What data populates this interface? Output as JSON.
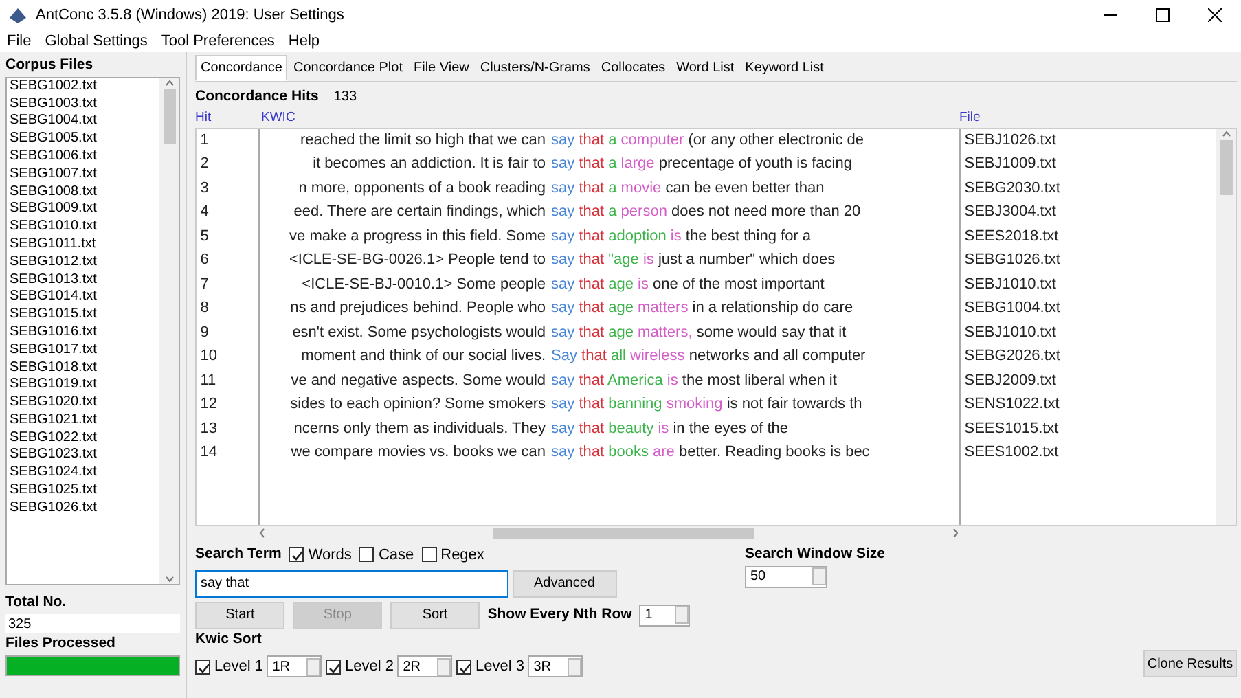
{
  "window": {
    "title": "AntConc 3.5.8 (Windows) 2019: User Settings"
  },
  "menu": [
    "File",
    "Global Settings",
    "Tool Preferences",
    "Help"
  ],
  "corpus_files": {
    "label": "Corpus Files",
    "files": [
      "SEBG1002.txt",
      "SEBG1003.txt",
      "SEBG1004.txt",
      "SEBG1005.txt",
      "SEBG1006.txt",
      "SEBG1007.txt",
      "SEBG1008.txt",
      "SEBG1009.txt",
      "SEBG1010.txt",
      "SEBG1011.txt",
      "SEBG1012.txt",
      "SEBG1013.txt",
      "SEBG1014.txt",
      "SEBG1015.txt",
      "SEBG1016.txt",
      "SEBG1017.txt",
      "SEBG1018.txt",
      "SEBG1019.txt",
      "SEBG1020.txt",
      "SEBG1021.txt",
      "SEBG1022.txt",
      "SEBG1023.txt",
      "SEBG1024.txt",
      "SEBG1025.txt",
      "SEBG1026.txt"
    ],
    "total_label": "Total No.",
    "total": "325",
    "processed": {
      "label": "Files Processed",
      "level": 1
    }
  },
  "tabs": [
    {
      "label": "Concordance",
      "selected": true
    },
    {
      "label": "Concordance Plot",
      "selected": false
    },
    {
      "label": "File View",
      "selected": false
    },
    {
      "label": "Clusters/N-Grams",
      "selected": false
    },
    {
      "label": "Collocates",
      "selected": false
    },
    {
      "label": "Word List",
      "selected": false
    },
    {
      "label": "Keyword List",
      "selected": false
    }
  ],
  "hits_label": "Concordance Hits",
  "hits": "133",
  "table": {
    "columns": [
      "Hit",
      "KWIC",
      "File"
    ],
    "rows": [
      {
        "hit": "1",
        "left": "reached the limit so high that we can",
        "segments": [
          {
            "text": "say",
            "color": "#4a86d8"
          },
          {
            "text": "that",
            "color": "#d8303a"
          },
          {
            "text": "a",
            "color": "#3cb44b"
          },
          {
            "text": "computer",
            "color": "#d45fc8"
          }
        ],
        "right": " (or any other electronic de",
        "file": "SEBJ1026.txt"
      },
      {
        "hit": "2",
        "left": "it becomes an addiction. It is fair to",
        "segments": [
          {
            "text": "say",
            "color": "#4a86d8"
          },
          {
            "text": "that",
            "color": "#d8303a"
          },
          {
            "text": "a",
            "color": "#3cb44b"
          },
          {
            "text": "large",
            "color": "#d45fc8"
          }
        ],
        "right": " precentage of youth is facing",
        "file": "SEBJ1009.txt"
      },
      {
        "hit": "3",
        "left": "n more, opponents of a book reading",
        "segments": [
          {
            "text": "say",
            "color": "#4a86d8"
          },
          {
            "text": "that",
            "color": "#d8303a"
          },
          {
            "text": "a",
            "color": "#3cb44b"
          },
          {
            "text": "movie",
            "color": "#d45fc8"
          }
        ],
        "right": " can be even better than",
        "file": "SEBG2030.txt"
      },
      {
        "hit": "4",
        "left": "eed. There are certain findings, which",
        "segments": [
          {
            "text": "say",
            "color": "#4a86d8"
          },
          {
            "text": "that",
            "color": "#d8303a"
          },
          {
            "text": "a",
            "color": "#3cb44b"
          },
          {
            "text": "person",
            "color": "#d45fc8"
          }
        ],
        "right": " does not need more than 20",
        "file": "SEBJ3004.txt"
      },
      {
        "hit": "5",
        "left": "ve make a progress in this field. Some",
        "segments": [
          {
            "text": "say",
            "color": "#4a86d8"
          },
          {
            "text": "that",
            "color": "#d8303a"
          },
          {
            "text": "adoption",
            "color": "#3cb44b"
          },
          {
            "text": "is",
            "color": "#d45fc8"
          }
        ],
        "right": " the best thing for a",
        "file": "SEES2018.txt"
      },
      {
        "hit": "6",
        "left": "<ICLE-SE-BG-0026.1>  People tend to",
        "segments": [
          {
            "text": "say",
            "color": "#4a86d8"
          },
          {
            "text": "that",
            "color": "#d8303a"
          },
          {
            "text": "\"age",
            "color": "#3cb44b"
          },
          {
            "text": "is",
            "color": "#d45fc8"
          }
        ],
        "right": " just a number\" which does",
        "file": "SEBG1026.txt"
      },
      {
        "hit": "7",
        "left": "<ICLE-SE-BJ-0010.1>  Some people",
        "segments": [
          {
            "text": "say",
            "color": "#4a86d8"
          },
          {
            "text": "that",
            "color": "#d8303a"
          },
          {
            "text": "age",
            "color": "#3cb44b"
          },
          {
            "text": "is",
            "color": "#d45fc8"
          }
        ],
        "right": " one of the most important",
        "file": "SEBJ1010.txt"
      },
      {
        "hit": "8",
        "left": "ns and prejudices behind. People who",
        "segments": [
          {
            "text": "say",
            "color": "#4a86d8"
          },
          {
            "text": "that",
            "color": "#d8303a"
          },
          {
            "text": "age",
            "color": "#3cb44b"
          },
          {
            "text": "matters",
            "color": "#d45fc8"
          }
        ],
        "right": " in a relationship do care",
        "file": "SEBG1004.txt"
      },
      {
        "hit": "9",
        "left": "esn't exist. Some psychologists would",
        "segments": [
          {
            "text": "say",
            "color": "#4a86d8"
          },
          {
            "text": "that",
            "color": "#d8303a"
          },
          {
            "text": "age",
            "color": "#3cb44b"
          },
          {
            "text": "matters,",
            "color": "#d45fc8"
          }
        ],
        "right": " some would say that it",
        "file": "SEBJ1010.txt"
      },
      {
        "hit": "10",
        "left": "moment and think of our social lives.",
        "segments": [
          {
            "text": "Say",
            "color": "#4a86d8"
          },
          {
            "text": "that",
            "color": "#d8303a"
          },
          {
            "text": "all",
            "color": "#3cb44b"
          },
          {
            "text": "wireless",
            "color": "#d45fc8"
          }
        ],
        "right": " networks and all computer",
        "file": "SEBG2026.txt"
      },
      {
        "hit": "11",
        "left": "ve and negative aspects. Some would",
        "segments": [
          {
            "text": "say",
            "color": "#4a86d8"
          },
          {
            "text": "that",
            "color": "#d8303a"
          },
          {
            "text": "America",
            "color": "#3cb44b"
          },
          {
            "text": "is",
            "color": "#d45fc8"
          }
        ],
        "right": " the most liberal when it",
        "file": "SEBJ2009.txt"
      },
      {
        "hit": "12",
        "left": "sides to each opinion? Some smokers",
        "segments": [
          {
            "text": "say",
            "color": "#4a86d8"
          },
          {
            "text": "that",
            "color": "#d8303a"
          },
          {
            "text": "banning",
            "color": "#3cb44b"
          },
          {
            "text": "smoking",
            "color": "#d45fc8"
          }
        ],
        "right": " is not fair towards th",
        "file": "SENS1022.txt"
      },
      {
        "hit": "13",
        "left": "ncerns only them as individuals. They",
        "segments": [
          {
            "text": "say",
            "color": "#4a86d8"
          },
          {
            "text": "that",
            "color": "#d8303a"
          },
          {
            "text": "beauty",
            "color": "#3cb44b"
          },
          {
            "text": "is",
            "color": "#d45fc8"
          }
        ],
        "right": " in the eyes of the",
        "file": "SEES1015.txt"
      },
      {
        "hit": "14",
        "left": "we compare movies vs. books we can",
        "segments": [
          {
            "text": "say",
            "color": "#4a86d8"
          },
          {
            "text": "that",
            "color": "#d8303a"
          },
          {
            "text": "books",
            "color": "#3cb44b"
          },
          {
            "text": "are",
            "color": "#d45fc8"
          }
        ],
        "right": " better. Reading books is bec",
        "file": "SEES1002.txt"
      }
    ]
  },
  "search": {
    "label": "Search Term",
    "options": [
      {
        "label": "Words",
        "checked": true
      },
      {
        "label": "Case",
        "checked": false
      },
      {
        "label": "Regex",
        "checked": false
      }
    ],
    "value": "say that",
    "advanced": "Advanced"
  },
  "window_size": {
    "label": "Search Window Size",
    "value": "50"
  },
  "buttons": [
    {
      "label": "Start",
      "disabled": false
    },
    {
      "label": "Stop",
      "disabled": true
    },
    {
      "label": "Sort",
      "disabled": false
    }
  ],
  "nth_row": {
    "label": "Show Every Nth Row",
    "value": "1"
  },
  "kwic_sort": {
    "label": "Kwic Sort",
    "levels": [
      {
        "label": "Level 1",
        "checked": true,
        "value": "1R"
      },
      {
        "label": "Level 2",
        "checked": true,
        "value": "2R"
      },
      {
        "label": "Level 3",
        "checked": true,
        "value": "3R"
      }
    ]
  },
  "clone": "Clone Results"
}
